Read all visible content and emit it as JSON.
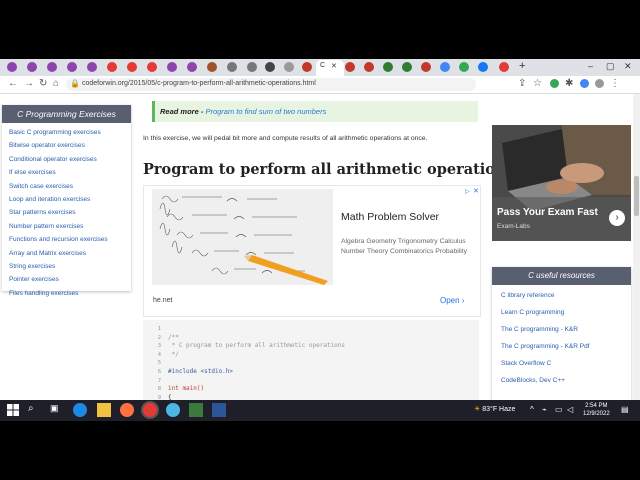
{
  "browser": {
    "active_tab_label": "C",
    "url": "codeforwin.org/2015/05/c-program-to-perform-all-arithmetic-operations.html",
    "new_tab_label": "+"
  },
  "sidebar_left": {
    "title": "C Programming Exercises",
    "items": [
      "Basic C programming exercises",
      "Bitwise operator exercises",
      "Conditional operator exercises",
      "If else exercises",
      "Switch case exercises",
      "Loop and iteration exercises",
      "Star patterns exercises",
      "Number pattern exercises",
      "Functions and recursion exercises",
      "Array and Matrix exercises",
      "String exercises",
      "Pointer exercises",
      "Files handling exercises"
    ]
  },
  "article": {
    "read_more_label": "Read more -",
    "read_more_link": "Program to find sum of two numbers",
    "intro": "In this exercise, we will pedal bit more and compute results of all arithmetic operations at once.",
    "heading": "Program to perform all arithmetic operations"
  },
  "ad": {
    "title": "Math Problem Solver",
    "description": "Algebra Geometry Trigonometry Calculus Number Theory Combinatorics Probability",
    "site": "he.net",
    "open_label": "Open"
  },
  "code": {
    "line_numbers": [
      "1",
      "2",
      "3",
      "4",
      "5",
      "6",
      "7",
      "8",
      "9"
    ],
    "lines": [
      {
        "text": "",
        "color": "#333333"
      },
      {
        "text": "/**",
        "color": "#999999"
      },
      {
        "text": " * C program to perform all arithmetic operations",
        "color": "#999999"
      },
      {
        "text": " */",
        "color": "#999999"
      },
      {
        "text": "",
        "color": "#333333"
      },
      {
        "text": "#include <stdio.h>",
        "color": "#3d5a99"
      },
      {
        "text": "",
        "color": "#333333"
      },
      {
        "text": "int main()",
        "color": "#c0392b"
      },
      {
        "text": "{",
        "color": "#333333"
      }
    ]
  },
  "right_ad": {
    "title": "Pass Your Exam Fast",
    "subtitle": "Exam-Labs"
  },
  "sidebar_right": {
    "title": "C useful resources",
    "items": [
      "C library reference",
      "Learn C programming",
      "The C programming - K&R",
      "The C programming - K&R Pdf",
      "Stack Overflow C",
      "CodeBlocks, Dev C++"
    ]
  },
  "taskbar": {
    "weather": "83°F  Haze",
    "time": "2:54 PM",
    "date": "12/9/2022"
  },
  "colors": {
    "sidebar_header": "#575f70",
    "link": "#2a5db0",
    "read_more_bg": "#e8f4e2",
    "accent": "#1a73e8"
  }
}
